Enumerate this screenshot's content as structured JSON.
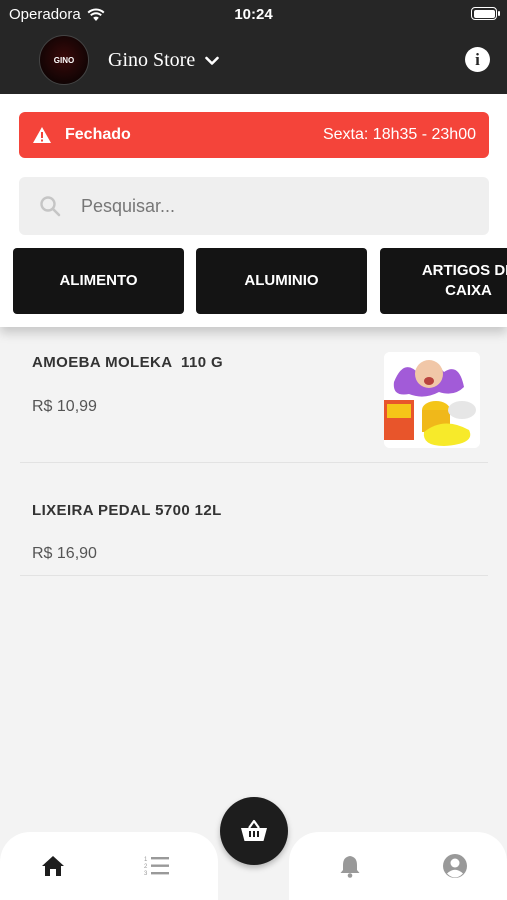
{
  "status_bar": {
    "carrier": "Operadora",
    "time": "10:24"
  },
  "header": {
    "logo_text": "GINO",
    "store_name": "Gino Store"
  },
  "banner": {
    "status": "Fechado",
    "hours": "Sexta: 18h35 - 23h00",
    "color": "#f4443a"
  },
  "search": {
    "placeholder": "Pesquisar..."
  },
  "categories": [
    {
      "label": "ALIMENTO"
    },
    {
      "label": "ALUMINIO"
    },
    {
      "label": "ARTIGOS DE CAIXA"
    }
  ],
  "products": [
    {
      "name": "AMOEBA MOLEKA  110 G",
      "price": "R$ 10,99",
      "has_image": true
    },
    {
      "name": "LIXEIRA PEDAL 5700 12L",
      "price": "R$ 16,90",
      "has_image": false
    }
  ],
  "bottom_nav": {
    "items": [
      "home-icon",
      "menu-list-icon",
      "cart-icon",
      "bell-icon",
      "account-icon"
    ],
    "active": "home-icon"
  }
}
